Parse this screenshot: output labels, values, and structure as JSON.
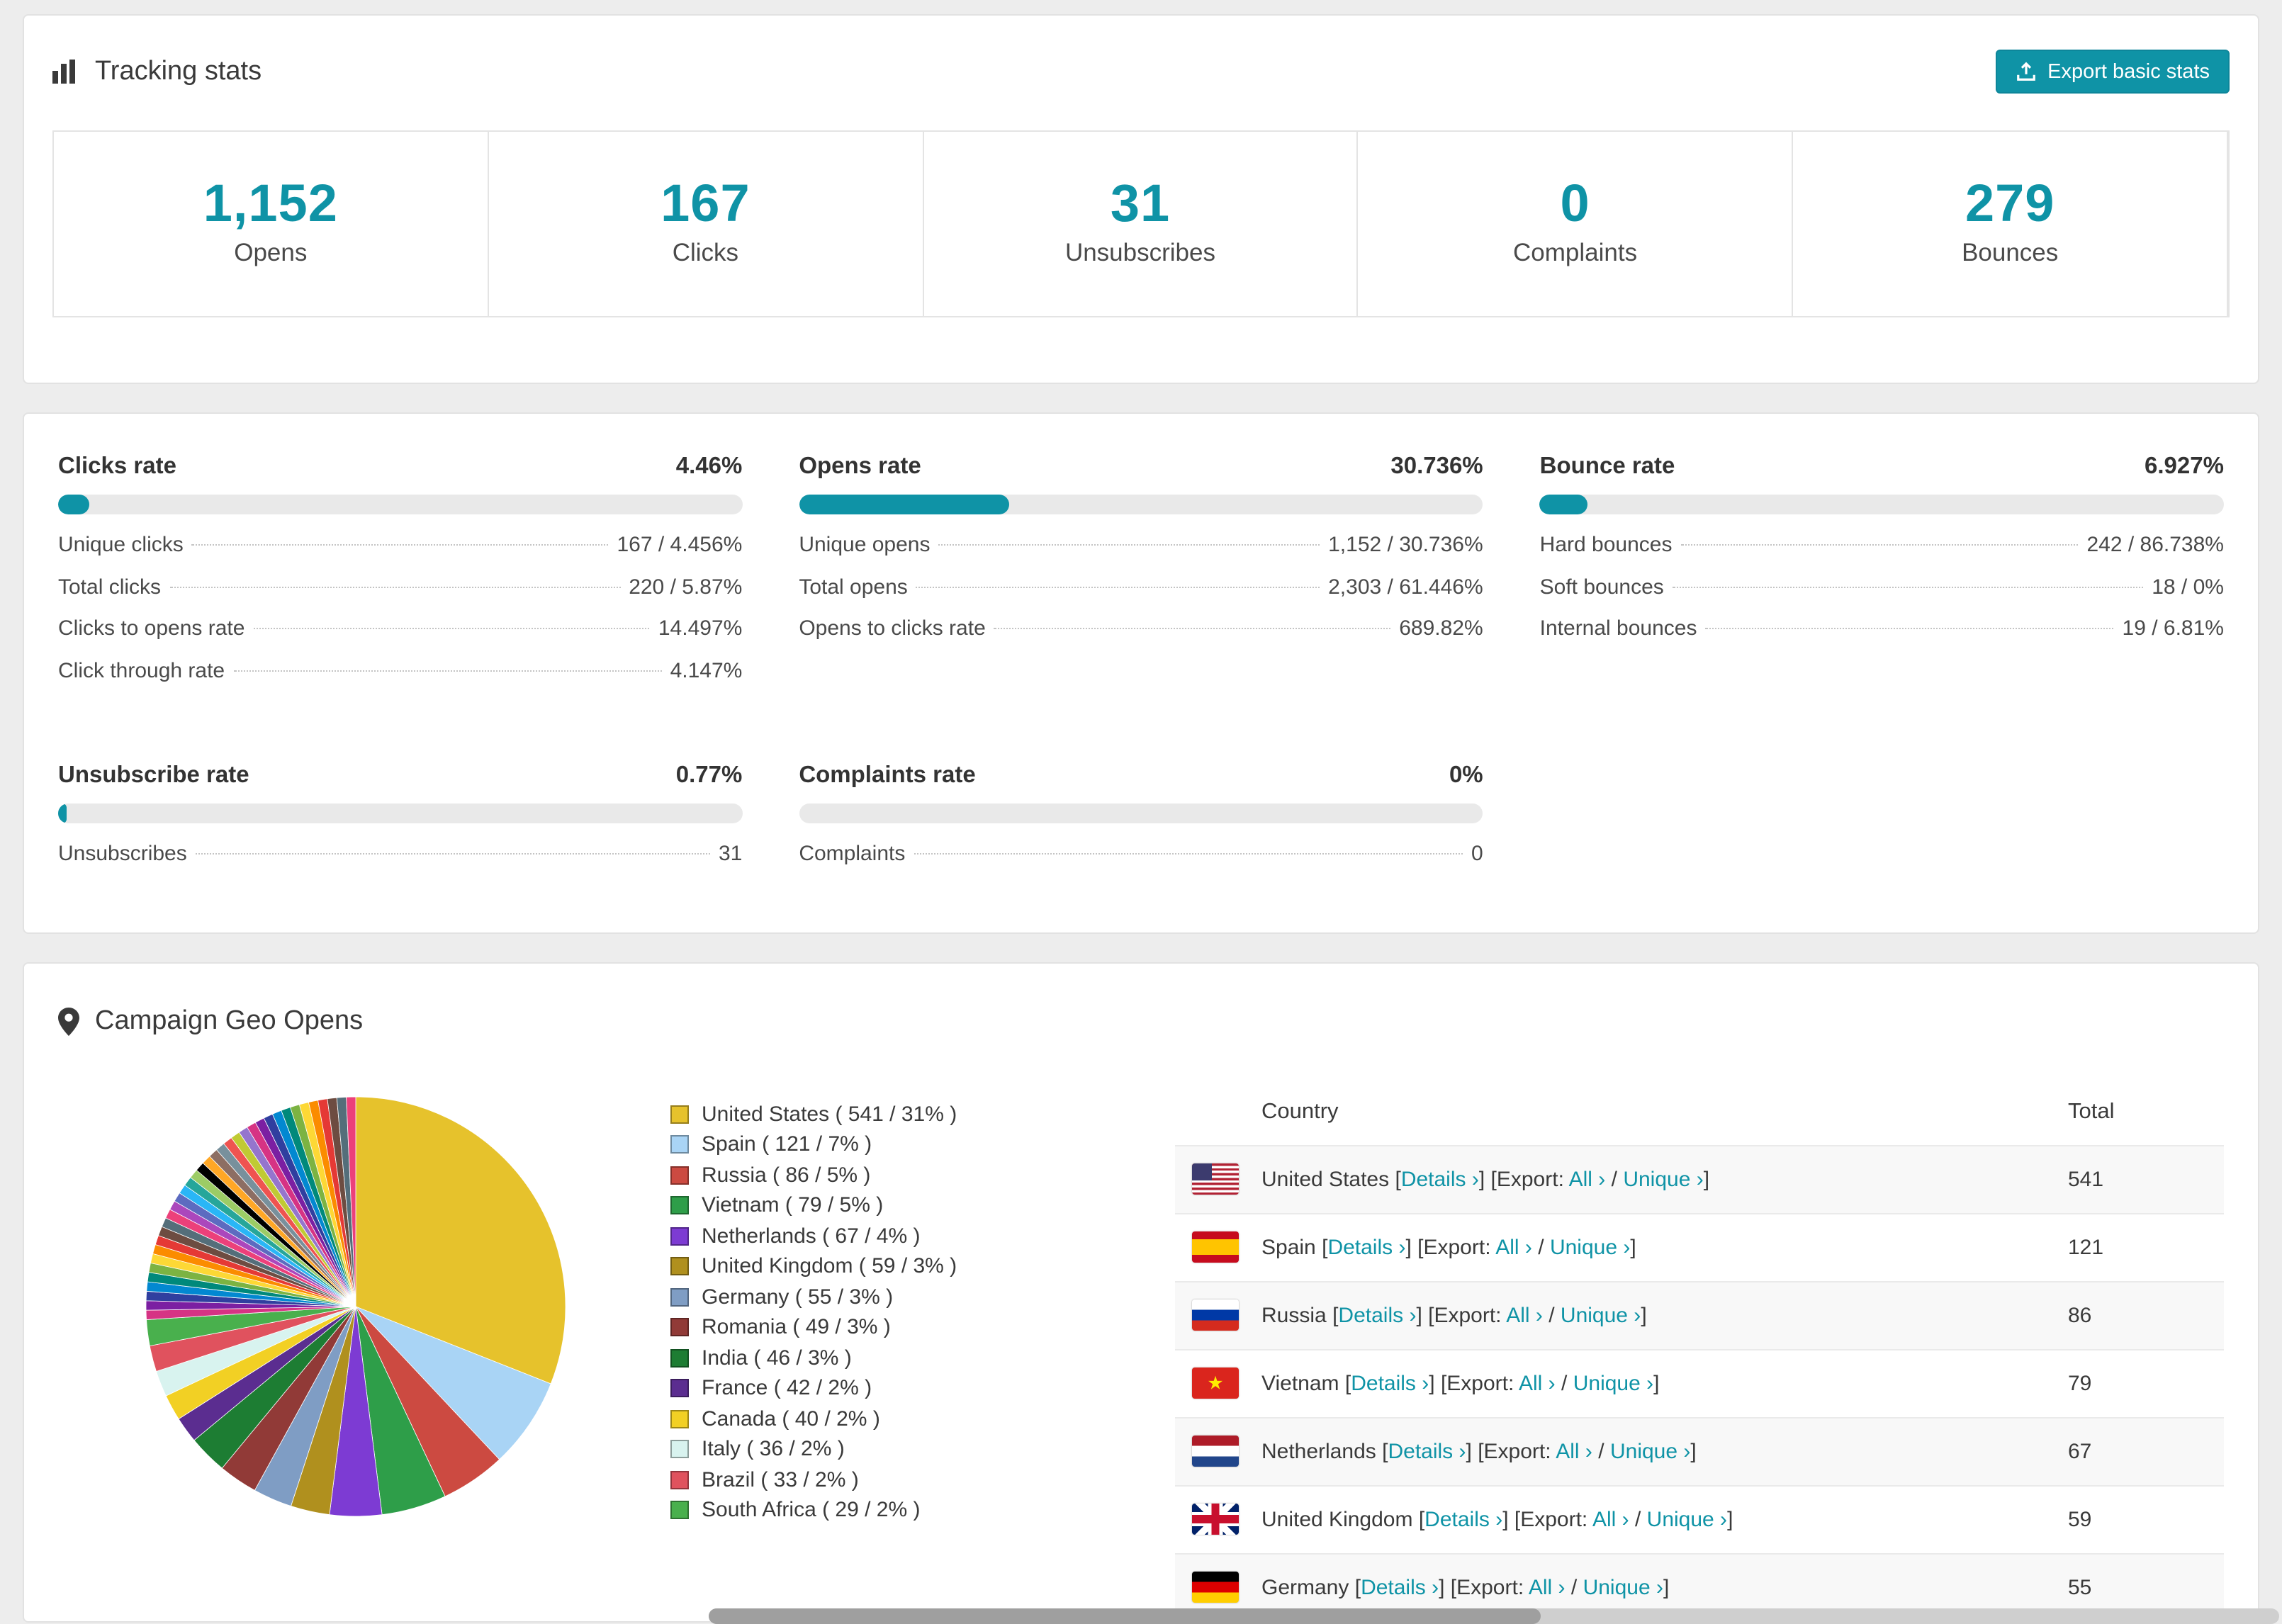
{
  "accent": "#0f93a6",
  "tracking": {
    "title": "Tracking stats",
    "export_label": "Export basic stats",
    "stats": [
      {
        "value": "1,152",
        "label": "Opens"
      },
      {
        "value": "167",
        "label": "Clicks"
      },
      {
        "value": "31",
        "label": "Unsubscribes"
      },
      {
        "value": "0",
        "label": "Complaints"
      },
      {
        "value": "279",
        "label": "Bounces"
      }
    ]
  },
  "rates": {
    "clicks": {
      "title": "Clicks rate",
      "value": "4.46%",
      "percent": 4.46,
      "rows": [
        {
          "label": "Unique clicks",
          "value": "167 / 4.456%"
        },
        {
          "label": "Total clicks",
          "value": "220 / 5.87%"
        },
        {
          "label": "Clicks to opens rate",
          "value": "14.497%"
        },
        {
          "label": "Click through rate",
          "value": "4.147%"
        }
      ]
    },
    "opens": {
      "title": "Opens rate",
      "value": "30.736%",
      "percent": 30.736,
      "rows": [
        {
          "label": "Unique opens",
          "value": "1,152 / 30.736%"
        },
        {
          "label": "Total opens",
          "value": "2,303 / 61.446%"
        },
        {
          "label": "Opens to clicks rate",
          "value": "689.82%"
        }
      ]
    },
    "bounce": {
      "title": "Bounce rate",
      "value": "6.927%",
      "percent": 6.927,
      "rows": [
        {
          "label": "Hard bounces",
          "value": "242 / 86.738%"
        },
        {
          "label": "Soft bounces",
          "value": "18 / 0%"
        },
        {
          "label": "Internal bounces",
          "value": "19 / 6.81%"
        }
      ]
    },
    "unsubscribe": {
      "title": "Unsubscribe rate",
      "value": "0.77%",
      "percent": 0.77,
      "rows": [
        {
          "label": "Unsubscribes",
          "value": "31"
        }
      ]
    },
    "complaints": {
      "title": "Complaints rate",
      "value": "0%",
      "percent": 0,
      "rows": [
        {
          "label": "Complaints",
          "value": "0"
        }
      ]
    }
  },
  "geo": {
    "title": "Campaign Geo Opens",
    "table": {
      "headers": [
        "Country",
        "Total"
      ],
      "labels": {
        "bracket_open": "[",
        "details": "Details ›",
        "bracket_close": "]",
        "export_prefix": "[Export:",
        "all": "All ›",
        "slash": "/",
        "unique": "Unique ›"
      },
      "rows": [
        {
          "flag_class": "flag-us",
          "country": "United States",
          "total": "541"
        },
        {
          "flag_class": "flag-es",
          "country": "Spain",
          "total": "121"
        },
        {
          "flag_class": "flag-ru",
          "country": "Russia",
          "total": "86"
        },
        {
          "flag_class": "flag-vn",
          "country": "Vietnam",
          "total": "79"
        },
        {
          "flag_class": "flag-nl",
          "country": "Netherlands",
          "total": "67"
        },
        {
          "flag_class": "flag-gb",
          "country": "United Kingdom",
          "total": "59"
        },
        {
          "flag_class": "flag-de",
          "country": "Germany",
          "total": "55"
        }
      ]
    }
  },
  "chart_data": {
    "type": "pie",
    "title": "Campaign Geo Opens",
    "legend_position": "right",
    "slices": [
      {
        "label": "United States",
        "value": 541,
        "percent": 31,
        "color": "#e6c22c",
        "legend": "United States ( 541 / 31% )"
      },
      {
        "label": "Spain",
        "value": 121,
        "percent": 7,
        "color": "#a9d4f5",
        "legend": "Spain ( 121 / 7% )"
      },
      {
        "label": "Russia",
        "value": 86,
        "percent": 5,
        "color": "#cc4a41",
        "legend": "Russia ( 86 / 5% )"
      },
      {
        "label": "Vietnam",
        "value": 79,
        "percent": 5,
        "color": "#2e9e49",
        "legend": "Vietnam ( 79 / 5% )"
      },
      {
        "label": "Netherlands",
        "value": 67,
        "percent": 4,
        "color": "#7d3bd3",
        "legend": "Netherlands ( 67 / 4% )"
      },
      {
        "label": "United Kingdom",
        "value": 59,
        "percent": 3,
        "color": "#b0901e",
        "legend": "United Kingdom ( 59 / 3% )"
      },
      {
        "label": "Germany",
        "value": 55,
        "percent": 3,
        "color": "#7f9dc4",
        "legend": "Germany ( 55 / 3% )"
      },
      {
        "label": "Romania",
        "value": 49,
        "percent": 3,
        "color": "#913a37",
        "legend": "Romania ( 49 / 3% )"
      },
      {
        "label": "India",
        "value": 46,
        "percent": 3,
        "color": "#1d7d33",
        "legend": "India ( 46 / 3% )"
      },
      {
        "label": "France",
        "value": 42,
        "percent": 2,
        "color": "#5b2d90",
        "legend": "France ( 42 / 2% )"
      },
      {
        "label": "Canada",
        "value": 40,
        "percent": 2,
        "color": "#f2d024",
        "legend": "Canada ( 40 / 2% )"
      },
      {
        "label": "Italy",
        "value": 36,
        "percent": 2,
        "color": "#d8f3ef",
        "legend": "Italy ( 36 / 2% )"
      },
      {
        "label": "Brazil",
        "value": 33,
        "percent": 2,
        "color": "#e0525e",
        "legend": "Brazil ( 33 / 2% )"
      },
      {
        "label": "South Africa",
        "value": 29,
        "percent": 2,
        "color": "#49b04d",
        "legend": "South Africa ( 29 / 2% )"
      }
    ],
    "others_percent": 26,
    "others_slice_count": 36,
    "others_palette": [
      "#d63384",
      "#7b1fa2",
      "#303f9f",
      "#0288d1",
      "#00897b",
      "#7cb342",
      "#fdd835",
      "#fb8c00",
      "#e53935",
      "#6d4c41",
      "#546e7a",
      "#ec407a",
      "#ab47bc",
      "#5c6bc0",
      "#29b6f6",
      "#26a69a",
      "#9ccc65",
      "#000000",
      "#ffa726",
      "#8d6e63",
      "#78909c",
      "#ef5350",
      "#c0ca33",
      "#9575cd"
    ]
  }
}
